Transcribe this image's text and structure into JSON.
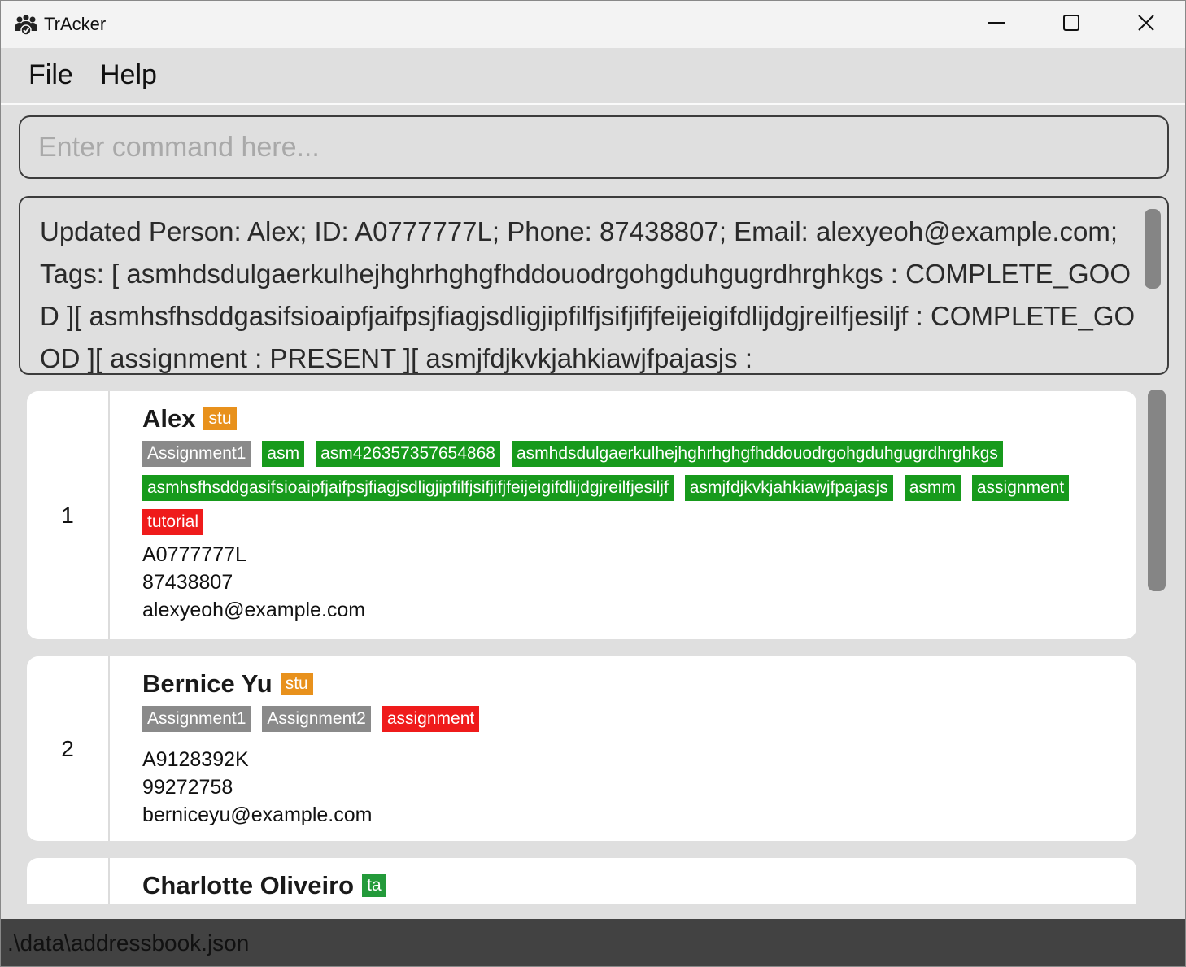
{
  "window": {
    "title": "TrAcker",
    "minimize_icon": "minimize-icon",
    "maximize_icon": "maximize-icon",
    "close_icon": "close-icon"
  },
  "menu": {
    "file": "File",
    "help": "Help"
  },
  "command": {
    "placeholder": "Enter command here...",
    "value": ""
  },
  "result": {
    "text": "Updated Person: Alex; ID: A0777777L; Phone: 87438807; Email: alexyeoh@example.com; Tags: [ asmhdsdulgaerkulhejhghrhghgfhddouodrgohgduhgugrdhrghkgs : COMPLETE_GOOD ][ asmhsfhsddgasifsioaipfjaifpsjfiagjsdligjipfilfjsifjifjfeijeigifdlijdgjreilfjesiljf : COMPLETE_GOOD ][ assignment : PRESENT ][ asmjfdjkvkjahkiawjfpajasjs :"
  },
  "persons": [
    {
      "index": "1",
      "name": "Alex",
      "role": "stu",
      "tags": [
        {
          "label": "Assignment1",
          "color": "#8a8a8a"
        },
        {
          "label": "asm",
          "color": "#179a1c"
        },
        {
          "label": "asm426357357654868",
          "color": "#179a1c"
        },
        {
          "label": "asmhdsdulgaerkulhejhghrhghgfhddouodrgohgduhgugrdhrghkgs",
          "color": "#179a1c"
        },
        {
          "label": "asmhsfhsddgasifsioaipfjaifpsjfiagjsdligjipfilfjsifjifjfeijeigifdlijdgjreilfjesiljf",
          "color": "#179a1c"
        },
        {
          "label": "asmjfdjkvkjahkiawjfpajasjs",
          "color": "#179a1c"
        },
        {
          "label": "asmm",
          "color": "#179a1c"
        },
        {
          "label": "assignment",
          "color": "#179a1c"
        },
        {
          "label": "tutorial",
          "color": "#ef1b1b"
        }
      ],
      "id": "A0777777L",
      "phone": "87438807",
      "email": "alexyeoh@example.com"
    },
    {
      "index": "2",
      "name": "Bernice Yu",
      "role": "stu",
      "tags": [
        {
          "label": "Assignment1",
          "color": "#8a8a8a"
        },
        {
          "label": "Assignment2",
          "color": "#8a8a8a"
        },
        {
          "label": "assignment",
          "color": "#ef1b1b"
        }
      ],
      "id": "A9128392K",
      "phone": "99272758",
      "email": "berniceyu@example.com"
    },
    {
      "index": "",
      "name": "Charlotte Oliveiro",
      "role": "ta"
    }
  ],
  "status": {
    "path": ".\\data\\addressbook.json"
  },
  "colors": {
    "stu": "#e8911c",
    "ta": "#239a3a",
    "tag_grey": "#8a8a8a",
    "tag_green": "#179a1c",
    "tag_red": "#ef1b1b"
  }
}
